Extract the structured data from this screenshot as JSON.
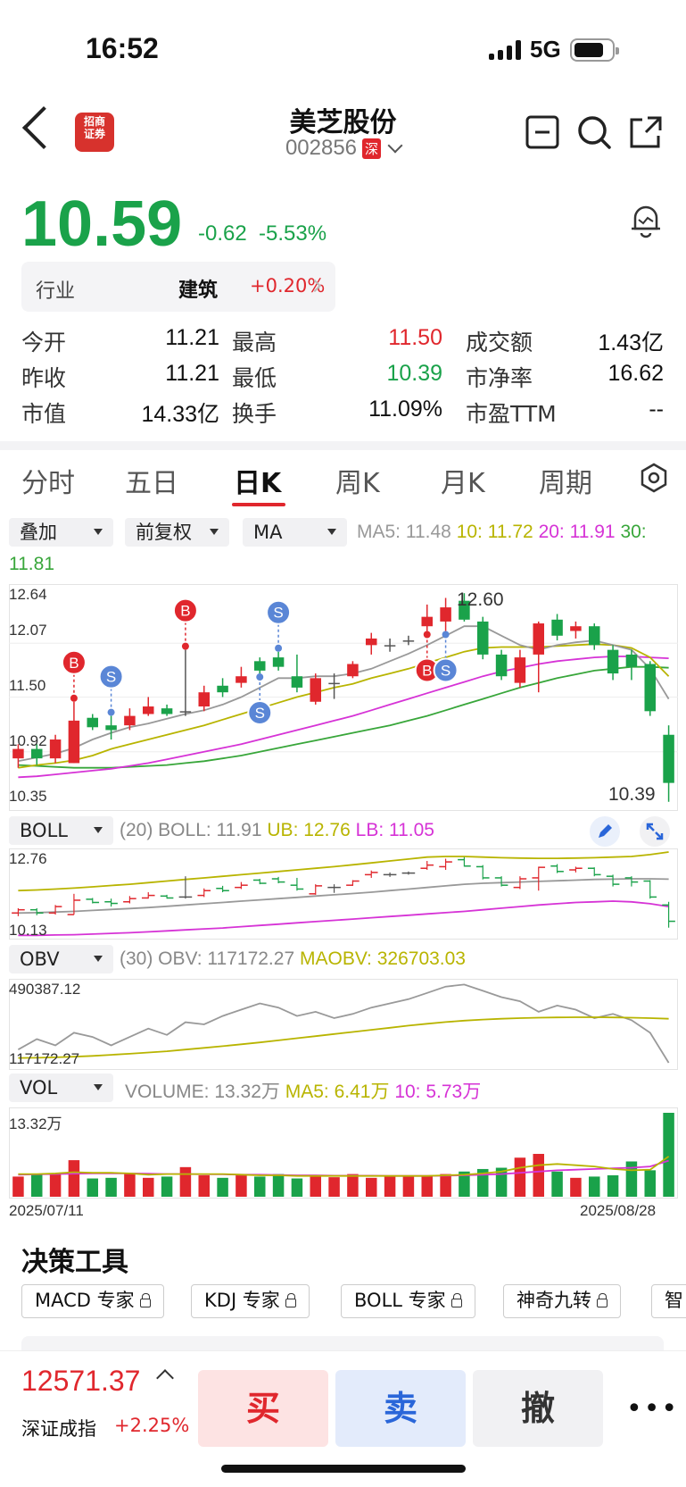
{
  "status": {
    "time": "16:52",
    "network": "5G"
  },
  "header": {
    "name": "美芝股份",
    "code": "002856",
    "market": "深",
    "logo_text": "招商\n证券"
  },
  "quote": {
    "price": "10.59",
    "change": "-0.62",
    "change_pct": "-5.53%"
  },
  "industry": {
    "label": "行业",
    "name": "建筑",
    "change": "+0.20%"
  },
  "stats": [
    [
      {
        "label": "今开",
        "value": "11.21",
        "color": "#111"
      },
      {
        "label": "最高",
        "value": "11.50",
        "color": "#e0272d"
      },
      {
        "label": "成交额",
        "value": "1.43亿",
        "color": "#111"
      }
    ],
    [
      {
        "label": "昨收",
        "value": "11.21",
        "color": "#111"
      },
      {
        "label": "最低",
        "value": "10.39",
        "color": "#1aa24a"
      },
      {
        "label": "市净率",
        "value": "16.62",
        "color": "#111"
      }
    ],
    [
      {
        "label": "市值",
        "value": "14.33亿",
        "color": "#111"
      },
      {
        "label": "换手",
        "value": "11.09%",
        "color": "#111"
      },
      {
        "label": "市盈TTM",
        "value": "--",
        "color": "#111"
      }
    ]
  ],
  "tabs": [
    "分时",
    "五日",
    "日K",
    "周K",
    "月K",
    "周期"
  ],
  "active_tab": "日K",
  "chart_controls": {
    "overlay": "叠加",
    "adjust": "前复权",
    "indicator": "MA"
  },
  "ma_legend": {
    "ma5": "MA5: 11.48",
    "ma10": "10: 11.72",
    "ma20": "20: 11.91",
    "ma30_label": "30:",
    "ma30_val": "11.81"
  },
  "boll_legend": {
    "dropdown": "BOLL",
    "text": "(20) BOLL: 11.91",
    "ub": "UB: 12.76",
    "lb": "LB: 11.05"
  },
  "obv_legend": {
    "dropdown": "OBV",
    "text": "(30) OBV: 117172.27",
    "maobv": "MAOBV: 326703.03"
  },
  "vol_legend": {
    "dropdown": "VOL",
    "text": "VOLUME: 13.32万",
    "ma5": "MA5: 6.41万",
    "ma10": "10: 5.73万"
  },
  "chart_data": {
    "type": "candlestick",
    "price_axis": {
      "max": "12.64",
      "mid1": "12.07",
      "mid2": "11.50",
      "low": "10.92",
      "min": "10.35",
      "high_mark": "12.60",
      "low_mark": "10.39"
    },
    "boll_axis": {
      "max": "12.76",
      "min": "10.13"
    },
    "obv_axis": {
      "max": "490387.12",
      "min": "117172.27"
    },
    "vol_axis": {
      "max": "13.32万"
    },
    "dates": {
      "start": "2025/07/11",
      "end": "2025/08/28"
    },
    "candles": [
      {
        "o": 10.85,
        "c": 10.95,
        "h": 11.0,
        "l": 10.75
      },
      {
        "o": 10.95,
        "c": 10.85,
        "h": 11.0,
        "l": 10.78
      },
      {
        "o": 10.85,
        "c": 11.05,
        "h": 11.1,
        "l": 10.8
      },
      {
        "o": 10.8,
        "c": 11.25,
        "h": 11.45,
        "l": 10.8
      },
      {
        "o": 11.28,
        "c": 11.18,
        "h": 11.32,
        "l": 11.15
      },
      {
        "o": 11.2,
        "c": 11.15,
        "h": 11.3,
        "l": 11.05
      },
      {
        "o": 11.2,
        "c": 11.3,
        "h": 11.38,
        "l": 11.15
      },
      {
        "o": 11.32,
        "c": 11.4,
        "h": 11.5,
        "l": 11.3
      },
      {
        "o": 11.38,
        "c": 11.32,
        "h": 11.42,
        "l": 11.3
      },
      {
        "o": 11.35,
        "c": 11.35,
        "h": 12.0,
        "l": 11.3
      },
      {
        "o": 11.4,
        "c": 11.55,
        "h": 11.62,
        "l": 11.35
      },
      {
        "o": 11.62,
        "c": 11.55,
        "h": 11.7,
        "l": 11.5
      },
      {
        "o": 11.65,
        "c": 11.72,
        "h": 11.82,
        "l": 11.6
      },
      {
        "o": 11.88,
        "c": 11.78,
        "h": 11.92,
        "l": 11.75
      },
      {
        "o": 11.92,
        "c": 11.82,
        "h": 11.98,
        "l": 11.78
      },
      {
        "o": 11.72,
        "c": 11.6,
        "h": 11.95,
        "l": 11.55
      },
      {
        "o": 11.45,
        "c": 11.7,
        "h": 11.75,
        "l": 11.42
      },
      {
        "o": 11.65,
        "c": 11.65,
        "h": 11.75,
        "l": 11.48
      },
      {
        "o": 11.72,
        "c": 11.85,
        "h": 11.88,
        "l": 11.7
      },
      {
        "o": 12.05,
        "c": 12.12,
        "h": 12.18,
        "l": 11.95
      },
      {
        "o": 12.05,
        "c": 12.05,
        "h": 12.12,
        "l": 11.98
      },
      {
        "o": 12.1,
        "c": 12.1,
        "h": 12.15,
        "l": 12.05
      },
      {
        "o": 12.25,
        "c": 12.35,
        "h": 12.48,
        "l": 12.2
      },
      {
        "o": 12.3,
        "c": 12.45,
        "h": 12.55,
        "l": 12.2
      },
      {
        "o": 12.52,
        "c": 12.32,
        "h": 12.6,
        "l": 12.3
      },
      {
        "o": 12.3,
        "c": 11.95,
        "h": 12.35,
        "l": 11.9
      },
      {
        "o": 11.95,
        "c": 11.72,
        "h": 12.0,
        "l": 11.68
      },
      {
        "o": 11.65,
        "c": 11.92,
        "h": 12.0,
        "l": 11.6
      },
      {
        "o": 11.95,
        "c": 12.28,
        "h": 12.3,
        "l": 11.55
      },
      {
        "o": 12.32,
        "c": 12.15,
        "h": 12.38,
        "l": 12.1
      },
      {
        "o": 12.2,
        "c": 12.25,
        "h": 12.3,
        "l": 12.12
      },
      {
        "o": 12.25,
        "c": 12.05,
        "h": 12.28,
        "l": 12.0
      },
      {
        "o": 12.0,
        "c": 11.75,
        "h": 12.05,
        "l": 11.68
      },
      {
        "o": 11.95,
        "c": 11.82,
        "h": 12.0,
        "l": 11.68
      },
      {
        "o": 11.85,
        "c": 11.35,
        "h": 11.88,
        "l": 11.3
      },
      {
        "o": 11.1,
        "c": 10.59,
        "h": 11.2,
        "l": 10.39
      }
    ],
    "ma5": [
      10.82,
      10.86,
      10.9,
      10.96,
      11.05,
      11.12,
      11.18,
      11.22,
      11.27,
      11.32,
      11.36,
      11.42,
      11.5,
      11.6,
      11.7,
      11.7,
      11.72,
      11.72,
      11.75,
      11.8,
      11.88,
      11.96,
      12.05,
      12.15,
      12.25,
      12.25,
      12.15,
      12.05,
      12.0,
      12.05,
      12.08,
      12.1,
      12.05,
      12.0,
      11.8,
      11.48
    ],
    "ma10": [
      10.75,
      10.78,
      10.8,
      10.83,
      10.88,
      10.95,
      11.0,
      11.05,
      11.1,
      11.15,
      11.2,
      11.26,
      11.32,
      11.38,
      11.44,
      11.5,
      11.55,
      11.6,
      11.64,
      11.7,
      11.75,
      11.8,
      11.86,
      11.92,
      11.98,
      12.02,
      12.03,
      12.03,
      12.03,
      12.04,
      12.05,
      12.06,
      12.05,
      12.02,
      11.92,
      11.72
    ],
    "ma20": [
      10.65,
      10.66,
      10.68,
      10.7,
      10.72,
      10.74,
      10.77,
      10.8,
      10.84,
      10.88,
      10.92,
      10.96,
      11.0,
      11.05,
      11.1,
      11.15,
      11.2,
      11.25,
      11.3,
      11.36,
      11.42,
      11.48,
      11.54,
      11.6,
      11.66,
      11.72,
      11.77,
      11.81,
      11.85,
      11.88,
      11.9,
      11.92,
      11.93,
      11.93,
      11.92,
      11.91
    ],
    "ma30": [
      10.78,
      10.77,
      10.76,
      10.75,
      10.75,
      10.75,
      10.76,
      10.77,
      10.78,
      10.8,
      10.82,
      10.85,
      10.88,
      10.92,
      10.96,
      11.0,
      11.04,
      11.08,
      11.12,
      11.16,
      11.2,
      11.25,
      11.3,
      11.36,
      11.42,
      11.48,
      11.54,
      11.6,
      11.65,
      11.7,
      11.74,
      11.78,
      11.8,
      11.82,
      11.82,
      11.81
    ],
    "markers": [
      {
        "type": "B",
        "i": 3,
        "pos": "above"
      },
      {
        "type": "S",
        "i": 5,
        "pos": "above"
      },
      {
        "type": "B",
        "i": 9,
        "pos": "above"
      },
      {
        "type": "S",
        "i": 14,
        "pos": "above"
      },
      {
        "type": "S",
        "i": 13,
        "pos": "below"
      },
      {
        "type": "B",
        "i": 22,
        "pos": "below"
      },
      {
        "type": "S",
        "i": 23,
        "pos": "below"
      }
    ],
    "boll_ub": [
      11.55,
      11.57,
      11.6,
      11.63,
      11.67,
      11.71,
      11.75,
      11.8,
      11.85,
      11.9,
      11.95,
      12.0,
      12.05,
      12.1,
      12.15,
      12.2,
      12.25,
      12.3,
      12.36,
      12.42,
      12.48,
      12.54,
      12.6,
      12.62,
      12.62,
      12.6,
      12.58,
      12.57,
      12.56,
      12.56,
      12.57,
      12.58,
      12.6,
      12.62,
      12.68,
      12.76
    ],
    "boll_mid": [
      10.85,
      10.86,
      10.88,
      10.9,
      10.93,
      10.96,
      10.99,
      11.02,
      11.06,
      11.1,
      11.14,
      11.18,
      11.22,
      11.26,
      11.3,
      11.34,
      11.38,
      11.42,
      11.46,
      11.5,
      11.55,
      11.6,
      11.65,
      11.7,
      11.75,
      11.78,
      11.8,
      11.82,
      11.84,
      11.86,
      11.88,
      11.9,
      11.91,
      11.92,
      11.92,
      11.91
    ],
    "boll_lb": [
      10.15,
      10.15,
      10.16,
      10.17,
      10.19,
      10.21,
      10.23,
      10.26,
      10.29,
      10.32,
      10.35,
      10.38,
      10.42,
      10.46,
      10.5,
      10.54,
      10.58,
      10.62,
      10.66,
      10.7,
      10.74,
      10.78,
      10.82,
      10.86,
      10.9,
      10.95,
      11.0,
      11.05,
      11.1,
      11.14,
      11.18,
      11.2,
      11.22,
      11.2,
      11.14,
      11.05
    ],
    "obv": [
      180000,
      230000,
      200000,
      260000,
      240000,
      200000,
      240000,
      280000,
      250000,
      310000,
      300000,
      340000,
      370000,
      400000,
      380000,
      340000,
      360000,
      330000,
      350000,
      380000,
      400000,
      420000,
      450000,
      480000,
      490000,
      460000,
      430000,
      410000,
      360000,
      390000,
      370000,
      330000,
      350000,
      320000,
      260000,
      117172
    ],
    "maobv": [
      140000,
      141000,
      143000,
      146000,
      150000,
      155000,
      160000,
      166000,
      172000,
      180000,
      188000,
      196000,
      205000,
      214000,
      224000,
      234000,
      244000,
      254000,
      264000,
      274000,
      284000,
      294000,
      303000,
      311000,
      318000,
      323000,
      327000,
      330000,
      332000,
      333000,
      334000,
      334000,
      333000,
      332000,
      330000,
      326703
    ],
    "volume": [
      3.2,
      3.5,
      3.6,
      5.8,
      2.9,
      3.0,
      3.7,
      3.0,
      3.2,
      4.7,
      3.4,
      3.0,
      3.4,
      3.2,
      3.6,
      2.9,
      3.4,
      3.1,
      3.6,
      3.0,
      3.2,
      3.4,
      3.3,
      3.6,
      4.0,
      4.4,
      4.6,
      6.2,
      6.8,
      4.0,
      3.0,
      3.2,
      3.4,
      5.6,
      4.2,
      13.32
    ],
    "vol_ma5": [
      3.6,
      3.6,
      3.7,
      3.9,
      3.8,
      3.8,
      3.7,
      3.5,
      3.6,
      3.6,
      3.6,
      3.6,
      3.5,
      3.4,
      3.4,
      3.3,
      3.3,
      3.3,
      3.3,
      3.3,
      3.3,
      3.3,
      3.3,
      3.4,
      3.5,
      3.7,
      4.0,
      4.6,
      5.0,
      5.2,
      5.0,
      4.8,
      4.4,
      4.2,
      4.3,
      6.41
    ],
    "vol_ma10": [
      3.5,
      3.55,
      3.6,
      3.65,
      3.7,
      3.7,
      3.7,
      3.65,
      3.6,
      3.6,
      3.55,
      3.55,
      3.5,
      3.5,
      3.45,
      3.4,
      3.4,
      3.35,
      3.35,
      3.35,
      3.3,
      3.3,
      3.3,
      3.35,
      3.4,
      3.5,
      3.6,
      3.8,
      4.0,
      4.2,
      4.3,
      4.4,
      4.5,
      4.6,
      4.8,
      5.73
    ]
  },
  "tools": {
    "title": "决策工具",
    "items": [
      "MACD 专家",
      "KDJ 专家",
      "BOLL 专家",
      "神奇九转",
      "智"
    ]
  },
  "bottom": {
    "index_value": "12571.37",
    "index_name": "深证成指",
    "index_pct": "+2.25%",
    "buy": "买",
    "sell": "卖",
    "cancel": "撤",
    "more": "•••"
  },
  "colors": {
    "up": "#e0272d",
    "down": "#1aa24a",
    "ma5": "#999999",
    "ma10": "#b8b400",
    "ma20": "#d633d6",
    "ma30": "#38a63a"
  }
}
